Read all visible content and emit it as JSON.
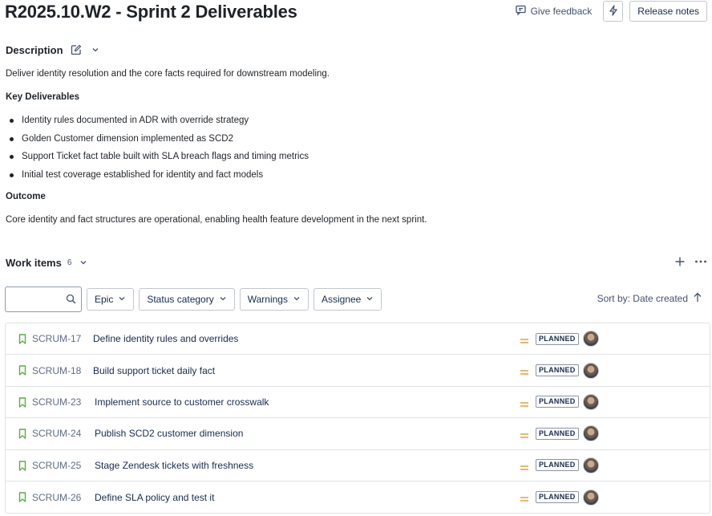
{
  "header": {
    "title": "R2025.10.W2 - Sprint 2 Deliverables",
    "feedback_label": "Give feedback",
    "release_notes_label": "Release notes"
  },
  "description": {
    "heading": "Description",
    "intro": "Deliver identity resolution and the core facts required for downstream modeling.",
    "key_heading": "Key Deliverables",
    "deliverables": [
      "Identity rules documented in ADR with override strategy",
      "Golden Customer dimension implemented as SCD2",
      "Support Ticket fact table built with SLA breach flags and timing metrics",
      "Initial test coverage established for identity and fact models"
    ],
    "outcome_heading": "Outcome",
    "outcome": "Core identity and fact structures are operational, enabling health feature development in the next sprint."
  },
  "work_items": {
    "heading": "Work items",
    "count": "6",
    "search_placeholder": "",
    "filters": [
      "Epic",
      "Status category",
      "Warnings",
      "Assignee"
    ],
    "sort_label": "Sort by: Date created",
    "items": [
      {
        "key": "SCRUM-17",
        "summary": "Define identity rules and overrides",
        "status": "PLANNED"
      },
      {
        "key": "SCRUM-18",
        "summary": "Build support ticket daily fact",
        "status": "PLANNED"
      },
      {
        "key": "SCRUM-23",
        "summary": "Implement source to customer crosswalk",
        "status": "PLANNED"
      },
      {
        "key": "SCRUM-24",
        "summary": "Publish SCD2 customer dimension",
        "status": "PLANNED"
      },
      {
        "key": "SCRUM-25",
        "summary": "Stage Zendesk tickets with freshness",
        "status": "PLANNED"
      },
      {
        "key": "SCRUM-26",
        "summary": "Define SLA policy and test it",
        "status": "PLANNED"
      }
    ]
  },
  "colors": {
    "bookmark": "#5aac44",
    "priority_medium": "#e2a03f",
    "text_primary": "#172b4d",
    "text_secondary": "#5e6c84"
  }
}
